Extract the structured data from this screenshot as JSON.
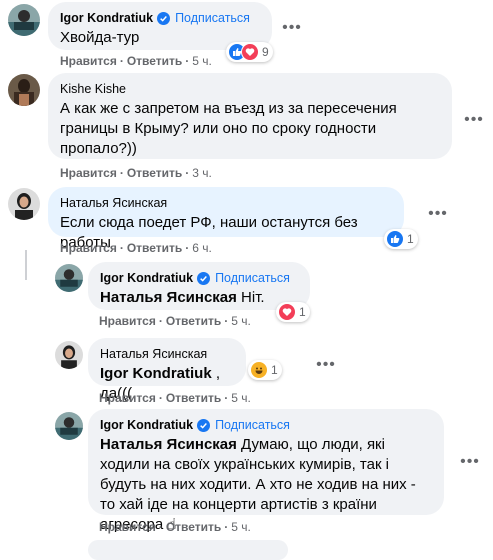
{
  "actions": {
    "like": "Нравится",
    "reply": "Ответить"
  },
  "comments": [
    {
      "author": "Igor Kondratiuk",
      "follow": "Подписаться",
      "text": "Хвойда-тур",
      "time": "5 ч.",
      "reaction_count": "9",
      "reactions": [
        "like-icon",
        "love-icon"
      ]
    },
    {
      "author": "Kishe Kishe",
      "text": "А как же с запретом на въезд из за пересечения границы в Крыму? или оно по сроку годности пропало?))",
      "time": "3 ч."
    },
    {
      "author": "Наталья Ясинская",
      "text": "Если сюда поедет РФ, наши останутся без работы",
      "time": "6 ч.",
      "reaction_count": "1",
      "reactions": [
        "like-icon"
      ]
    },
    {
      "author": "Igor Kondratiuk",
      "follow": "Подписаться",
      "mention": "Наталья Ясинская",
      "text": " Ніт.",
      "time": "5 ч.",
      "reaction_count": "1",
      "reactions": [
        "love-icon"
      ]
    },
    {
      "author": "Наталья Ясинская",
      "mention": "Igor Kondratiuk",
      "text": " , да(((",
      "time": "5 ч.",
      "reaction_count": "1",
      "reactions": [
        "haha-icon"
      ]
    },
    {
      "author": "Igor Kondratiuk",
      "follow": "Подписаться",
      "mention": "Наталья Ясинская",
      "text": " Думаю, що люди, які ходили на своїх українських кумирів, так і будуть на них ходити. А хто не ходив на них - то хай іде на концерти артистів з країни агресора ☝",
      "time": "5 ч."
    }
  ],
  "colors": {
    "bubble": "#f0f2f5",
    "highlight": "#e7f3ff",
    "link": "#1877f2",
    "meta": "#65676b"
  }
}
